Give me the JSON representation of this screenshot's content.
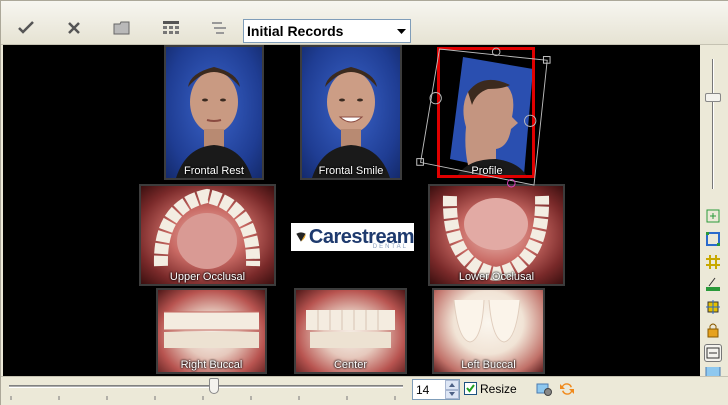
{
  "toolbar": {
    "buttons": [
      {
        "name": "accept",
        "icon": "checkmark-icon"
      },
      {
        "name": "cancel",
        "icon": "x-icon"
      },
      {
        "name": "open",
        "icon": "folder-icon"
      },
      {
        "name": "layout",
        "icon": "grid-layout-icon"
      },
      {
        "name": "align",
        "icon": "align-icon"
      }
    ],
    "template_select": {
      "value": "Initial Records"
    }
  },
  "photos": [
    {
      "id": "frontal-rest",
      "label": "Frontal Rest",
      "kind": "face"
    },
    {
      "id": "frontal-smile",
      "label": "Frontal Smile",
      "kind": "face"
    },
    {
      "id": "profile",
      "label": "Profile",
      "kind": "face",
      "selected": true
    },
    {
      "id": "upper-occlusal",
      "label": "Upper Occlusal",
      "kind": "mouth"
    },
    {
      "id": "lower-occlusal",
      "label": "Lower Occlusal",
      "kind": "mouth"
    },
    {
      "id": "right-buccal",
      "label": "Right Buccal",
      "kind": "teeth"
    },
    {
      "id": "center",
      "label": "Center",
      "kind": "teeth"
    },
    {
      "id": "left-buccal",
      "label": "Left Buccal",
      "kind": "teeth"
    }
  ],
  "logo": {
    "brand": "Carestream",
    "sub": "DENTAL"
  },
  "side_tools": [
    "fit-icon",
    "crop-icon",
    "grid-icon",
    "level-icon",
    "move-icon",
    "lock-icon",
    "frame-icon",
    "picture-icon"
  ],
  "bottom": {
    "size_value": "14",
    "resize_label": "Resize",
    "resize_checked": true,
    "colors": {
      "accent": "#e00000",
      "canvas": "#000000"
    }
  }
}
